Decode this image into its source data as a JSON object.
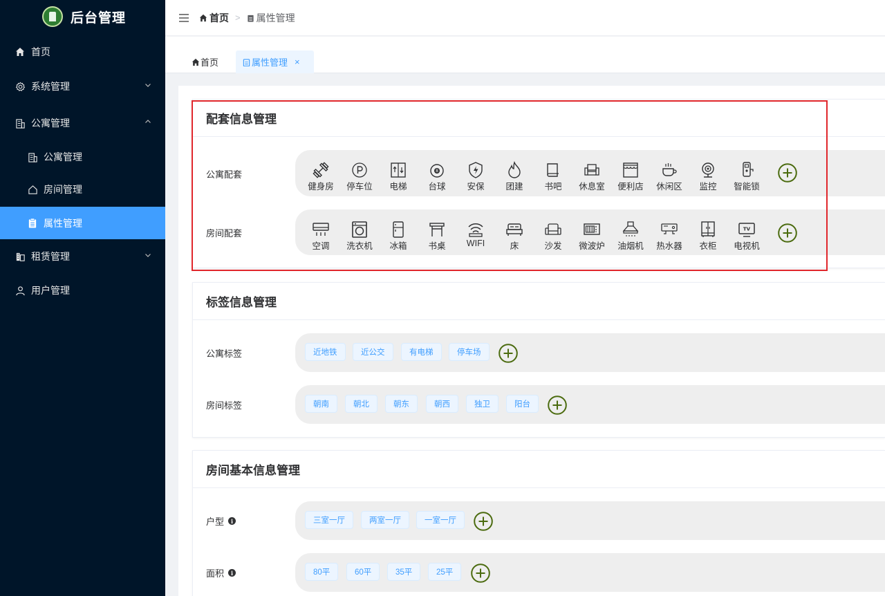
{
  "app": {
    "title": "后台管理"
  },
  "sidebar": {
    "items": [
      {
        "label": "首页",
        "icon": "home-icon"
      },
      {
        "label": "系统管理",
        "icon": "gear-icon"
      },
      {
        "label": "公寓管理",
        "icon": "building-icon"
      },
      {
        "label": "公寓管理",
        "icon": "building-icon"
      },
      {
        "label": "房间管理",
        "icon": "house-icon"
      },
      {
        "label": "属性管理",
        "icon": "clipboard-icon"
      },
      {
        "label": "租赁管理",
        "icon": "lease-icon"
      },
      {
        "label": "用户管理",
        "icon": "user-icon"
      }
    ]
  },
  "breadcrumb": {
    "home": "首页",
    "current": "属性管理"
  },
  "tabs": [
    {
      "label": "首页"
    },
    {
      "label": "属性管理",
      "close": "×"
    }
  ],
  "facility_card": {
    "title": "配套信息管理",
    "apartment": {
      "label": "公寓配套",
      "items": [
        "健身房",
        "停车位",
        "电梯",
        "台球",
        "安保",
        "团建",
        "书吧",
        "休息室",
        "便利店",
        "休闲区",
        "监控",
        "智能锁"
      ]
    },
    "room": {
      "label": "房间配套",
      "items": [
        "空调",
        "洗衣机",
        "冰箱",
        "书桌",
        "WIFI",
        "床",
        "沙发",
        "微波炉",
        "油烟机",
        "热水器",
        "衣柜",
        "电视机"
      ]
    }
  },
  "label_card": {
    "title": "标签信息管理",
    "apartment": {
      "label": "公寓标签",
      "tags": [
        "近地铁",
        "近公交",
        "有电梯",
        "停车场"
      ]
    },
    "room": {
      "label": "房间标签",
      "tags": [
        "朝南",
        "朝北",
        "朝东",
        "朝西",
        "独卫",
        "阳台"
      ]
    }
  },
  "room_info_card": {
    "title": "房间基本信息管理",
    "layout": {
      "label": "户型",
      "tags": [
        "三室一厅",
        "两室一厅",
        "一室一厅"
      ]
    },
    "area": {
      "label": "面积",
      "tags": [
        "80平",
        "60平",
        "35平",
        "25平"
      ]
    }
  },
  "colors": {
    "sidebar_bg": "#001529",
    "active": "#409eff",
    "add_button": "#4b6b0f",
    "highlight_border": "#e0262b"
  }
}
